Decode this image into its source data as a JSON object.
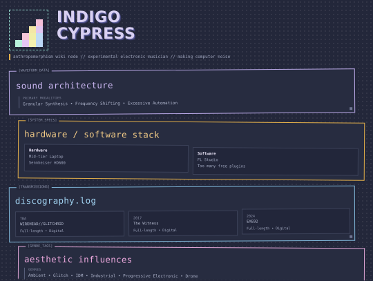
{
  "header": {
    "title_line1": "INDIGO",
    "title_line2": "CYPRESS",
    "tagline": "anthropomorphism wiki node // experimental electronic musician // making computer noise"
  },
  "sections": {
    "sound": {
      "tag": "[WAVEFORM_DATA]",
      "heading": "sound architecture",
      "label": "PRIMARY MODALITIES",
      "value": "Granular Synthesis • Frequency Shifting • Excessive Automation"
    },
    "stack": {
      "tag": "[SYSTEM_SPECS]",
      "heading": "hardware / software stack",
      "hardware": {
        "title": "Hardware",
        "lines": [
          "Mid-tier Laptop",
          "Sennheiser HD600"
        ]
      },
      "software": {
        "title": "Software",
        "lines": [
          "FL Studio",
          "Too many free plugins"
        ]
      }
    },
    "discography": {
      "tag": "[TRANSMISSIONS]",
      "heading": "discography.log",
      "releases": [
        {
          "year": "TBA",
          "title": "WIREHEAD//GLITCHRID",
          "detail": "Full-length • Digital"
        },
        {
          "year": "2017",
          "title": "The Witness",
          "detail": "Full-length • Digital"
        },
        {
          "year": "2024",
          "title": "EXE92",
          "detail": "Full-length • Digital"
        }
      ]
    },
    "influences": {
      "tag": "[GENRE_TAGS]",
      "heading": "aesthetic influences",
      "label": "GENRES",
      "value": "Ambient • Glitch • IDM • Industrial • Progressive Electronic • Drone"
    }
  },
  "colors": {
    "accent_teal": "#8fd6c9",
    "accent_lavender": "#c9b6f0",
    "accent_amber": "#e4b04a",
    "accent_blue": "#7fb6d8",
    "accent_pink": "#e0a6d6"
  }
}
